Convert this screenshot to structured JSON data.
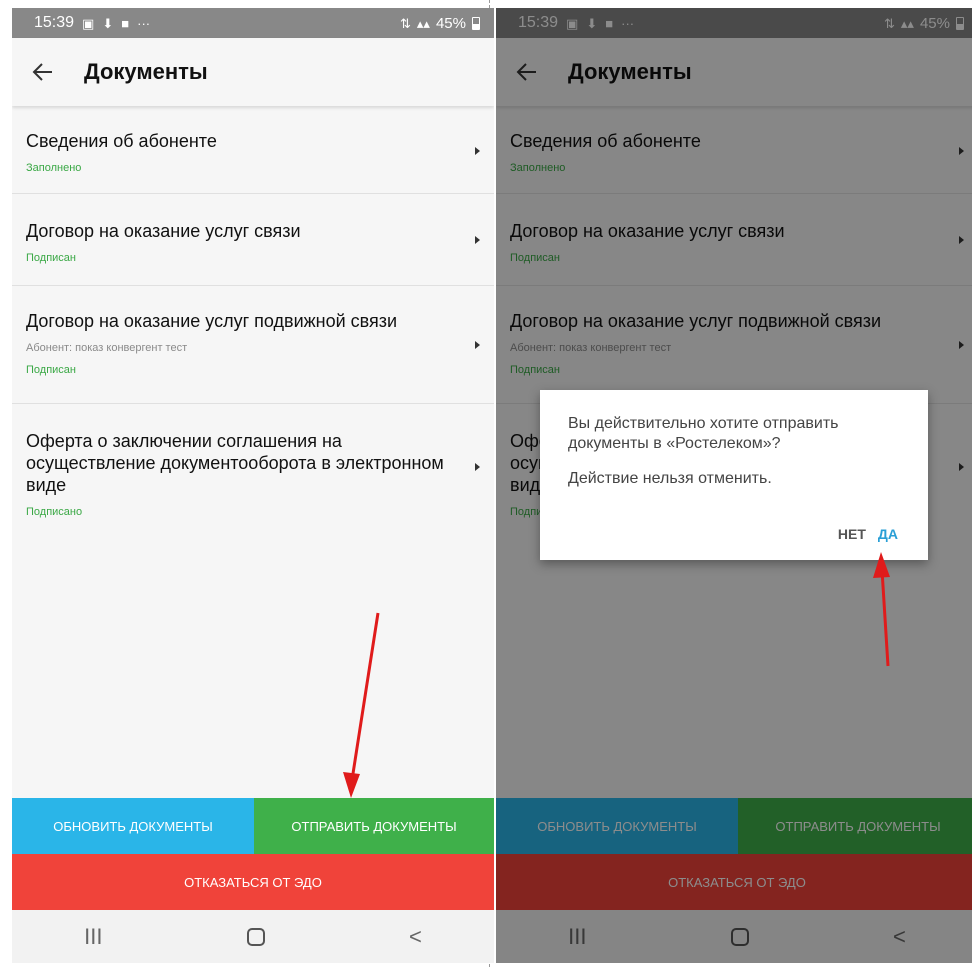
{
  "statusbar": {
    "time": "15:39",
    "battery": "45%",
    "dots": "···"
  },
  "appbar": {
    "title": "Документы"
  },
  "documents": [
    {
      "title": "Сведения об абоненте",
      "status": "Заполнено"
    },
    {
      "title": "Договор на оказание услуг связи",
      "status": "Подписан"
    },
    {
      "title": "Договор на оказание услуг подвижной связи",
      "subtitle": "Абонент: показ конвергент тест",
      "status": "Подписан"
    },
    {
      "title": "Оферта о заключении соглашения на осуществление документооборота в электронном виде",
      "status": "Подписано"
    }
  ],
  "buttons": {
    "refresh": "Обновить документы",
    "send": "Отправить документы",
    "refuse": "Отказаться от ЭДО"
  },
  "navbar": {
    "recent": "III",
    "back": "<"
  },
  "dialog": {
    "message": "Вы действительно хотите отправить документы в «Ростелеком»?",
    "warning": "Действие нельзя отменить.",
    "no": "НЕТ",
    "yes": "ДА"
  },
  "colors": {
    "refresh": "#2ab5e8",
    "send": "#3fb04a",
    "refuse": "#f0433a",
    "status_green": "#3aa845",
    "link_blue": "#2a9fd6",
    "annotation_arrow": "#e01b1b"
  }
}
